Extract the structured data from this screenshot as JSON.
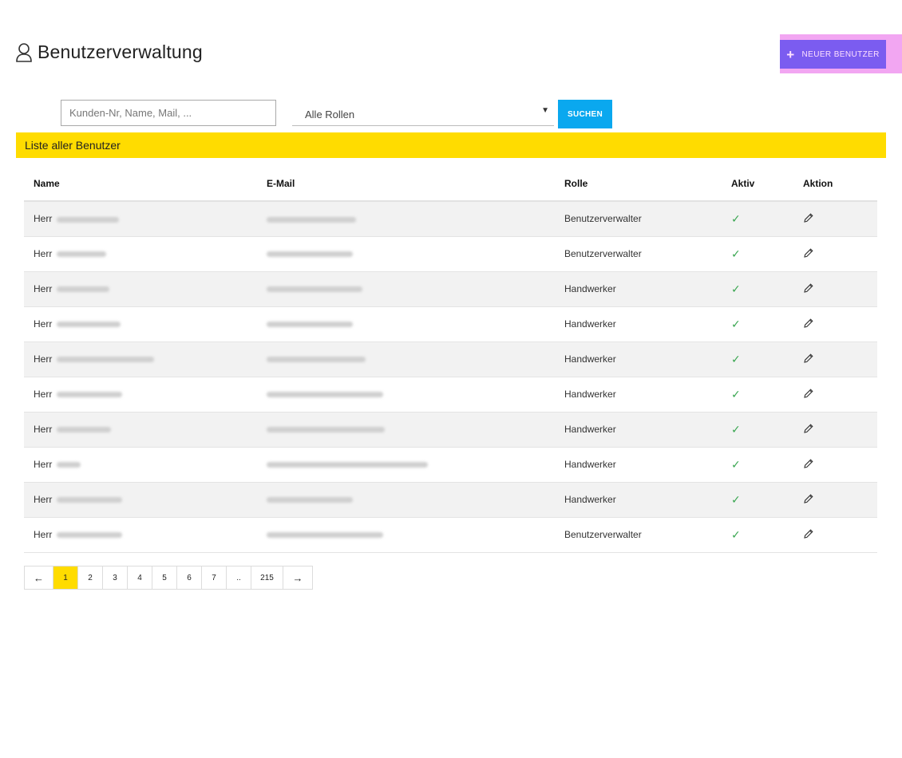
{
  "header": {
    "title": "Benutzerverwaltung",
    "icon": "user-icon"
  },
  "actions": {
    "new_user_label": "NEUER BENUTZER",
    "new_user_icon": "plus-icon"
  },
  "search": {
    "placeholder": "Kunden-Nr, Name, Mail, ...",
    "value": "",
    "role_selected": "Alle Rollen",
    "button_label": "SUCHEN"
  },
  "list": {
    "title": "Liste aller Benutzer"
  },
  "table": {
    "columns": [
      "Name",
      "E-Mail",
      "Rolle",
      "Aktiv",
      "Aktion"
    ],
    "rows": [
      {
        "salutation": "Herr",
        "role": "Benutzerverwalter",
        "active": "✓"
      },
      {
        "salutation": "Herr",
        "role": "Benutzerverwalter",
        "active": "✓"
      },
      {
        "salutation": "Herr",
        "role": "Handwerker",
        "active": "✓"
      },
      {
        "salutation": "Herr",
        "role": "Handwerker",
        "active": "✓"
      },
      {
        "salutation": "Herr",
        "role": "Handwerker",
        "active": "✓"
      },
      {
        "salutation": "Herr",
        "role": "Handwerker",
        "active": "✓"
      },
      {
        "salutation": "Herr",
        "role": "Handwerker",
        "active": "✓"
      },
      {
        "salutation": "Herr",
        "role": "Handwerker",
        "active": "✓"
      },
      {
        "salutation": "Herr",
        "role": "Handwerker",
        "active": "✓"
      },
      {
        "salutation": "Herr",
        "role": "Benutzerverwalter",
        "active": "✓"
      }
    ]
  },
  "pagination": {
    "prev": "←",
    "pages": [
      "1",
      "2",
      "3",
      "4",
      "5",
      "6",
      "7",
      "..",
      "215"
    ],
    "current": "1",
    "next": "→"
  },
  "colors": {
    "accent_yellow": "#ffdc00",
    "search_blue": "#0aa8ef",
    "new_user_purple": "#7b5cf0",
    "check_green": "#3aa651"
  }
}
